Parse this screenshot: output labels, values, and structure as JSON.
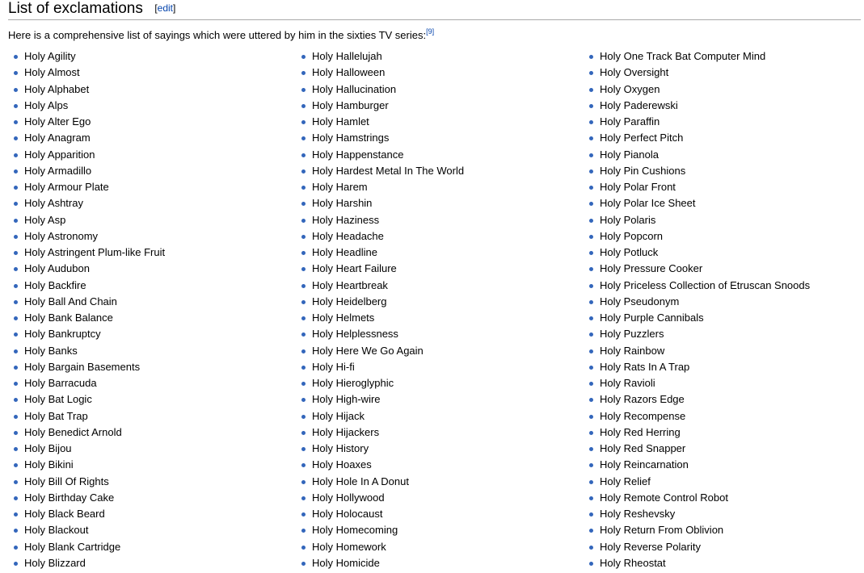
{
  "section": {
    "title": "List of exclamations",
    "edit_open": "[",
    "edit_label": "edit",
    "edit_close": "]"
  },
  "intro": {
    "text": "Here is a comprehensive list of sayings which were uttered by him in the sixties TV series:",
    "ref": "[9]"
  },
  "columns": [
    [
      "Holy Agility",
      "Holy Almost",
      "Holy Alphabet",
      "Holy Alps",
      "Holy Alter Ego",
      "Holy Anagram",
      "Holy Apparition",
      "Holy Armadillo",
      "Holy Armour Plate",
      "Holy Ashtray",
      "Holy Asp",
      "Holy Astronomy",
      "Holy Astringent Plum-like Fruit",
      "Holy Audubon",
      "Holy Backfire",
      "Holy Ball And Chain",
      "Holy Bank Balance",
      "Holy Bankruptcy",
      "Holy Banks",
      "Holy Bargain Basements",
      "Holy Barracuda",
      "Holy Bat Logic",
      "Holy Bat Trap",
      "Holy Benedict Arnold",
      "Holy Bijou",
      "Holy Bikini",
      "Holy Bill Of Rights",
      "Holy Birthday Cake",
      "Holy Black Beard",
      "Holy Blackout",
      "Holy Blank Cartridge",
      "Holy Blizzard"
    ],
    [
      "Holy Hallelujah",
      "Holy Halloween",
      "Holy Hallucination",
      "Holy Hamburger",
      "Holy Hamlet",
      "Holy Hamstrings",
      "Holy Happenstance",
      "Holy Hardest Metal In The World",
      "Holy Harem",
      "Holy Harshin",
      "Holy Haziness",
      "Holy Headache",
      "Holy Headline",
      "Holy Heart Failure",
      "Holy Heartbreak",
      "Holy Heidelberg",
      "Holy Helmets",
      "Holy Helplessness",
      "Holy Here We Go Again",
      "Holy Hi-fi",
      "Holy Hieroglyphic",
      "Holy High-wire",
      "Holy Hijack",
      "Holy Hijackers",
      "Holy History",
      "Holy Hoaxes",
      "Holy Hole In A Donut",
      "Holy Hollywood",
      "Holy Holocaust",
      "Holy Homecoming",
      "Holy Homework",
      "Holy Homicide"
    ],
    [
      "Holy One Track Bat Computer Mind",
      "Holy Oversight",
      "Holy Oxygen",
      "Holy Paderewski",
      "Holy Paraffin",
      "Holy Perfect Pitch",
      "Holy Pianola",
      "Holy Pin Cushions",
      "Holy Polar Front",
      "Holy Polar Ice Sheet",
      "Holy Polaris",
      "Holy Popcorn",
      "Holy Potluck",
      "Holy Pressure Cooker",
      "Holy Priceless Collection of Etruscan Snoods",
      "Holy Pseudonym",
      "Holy Purple Cannibals",
      "Holy Puzzlers",
      "Holy Rainbow",
      "Holy Rats In A Trap",
      "Holy Ravioli",
      "Holy Razors Edge",
      "Holy Recompense",
      "Holy Red Herring",
      "Holy Red Snapper",
      "Holy Reincarnation",
      "Holy Relief",
      "Holy Remote Control Robot",
      "Holy Reshevsky",
      "Holy Return From Oblivion",
      "Holy Reverse Polarity",
      "Holy Rheostat"
    ]
  ],
  "colors": {
    "link": "#0645ad",
    "bullet": "#3366bb",
    "rule": "#aaaaaa"
  }
}
